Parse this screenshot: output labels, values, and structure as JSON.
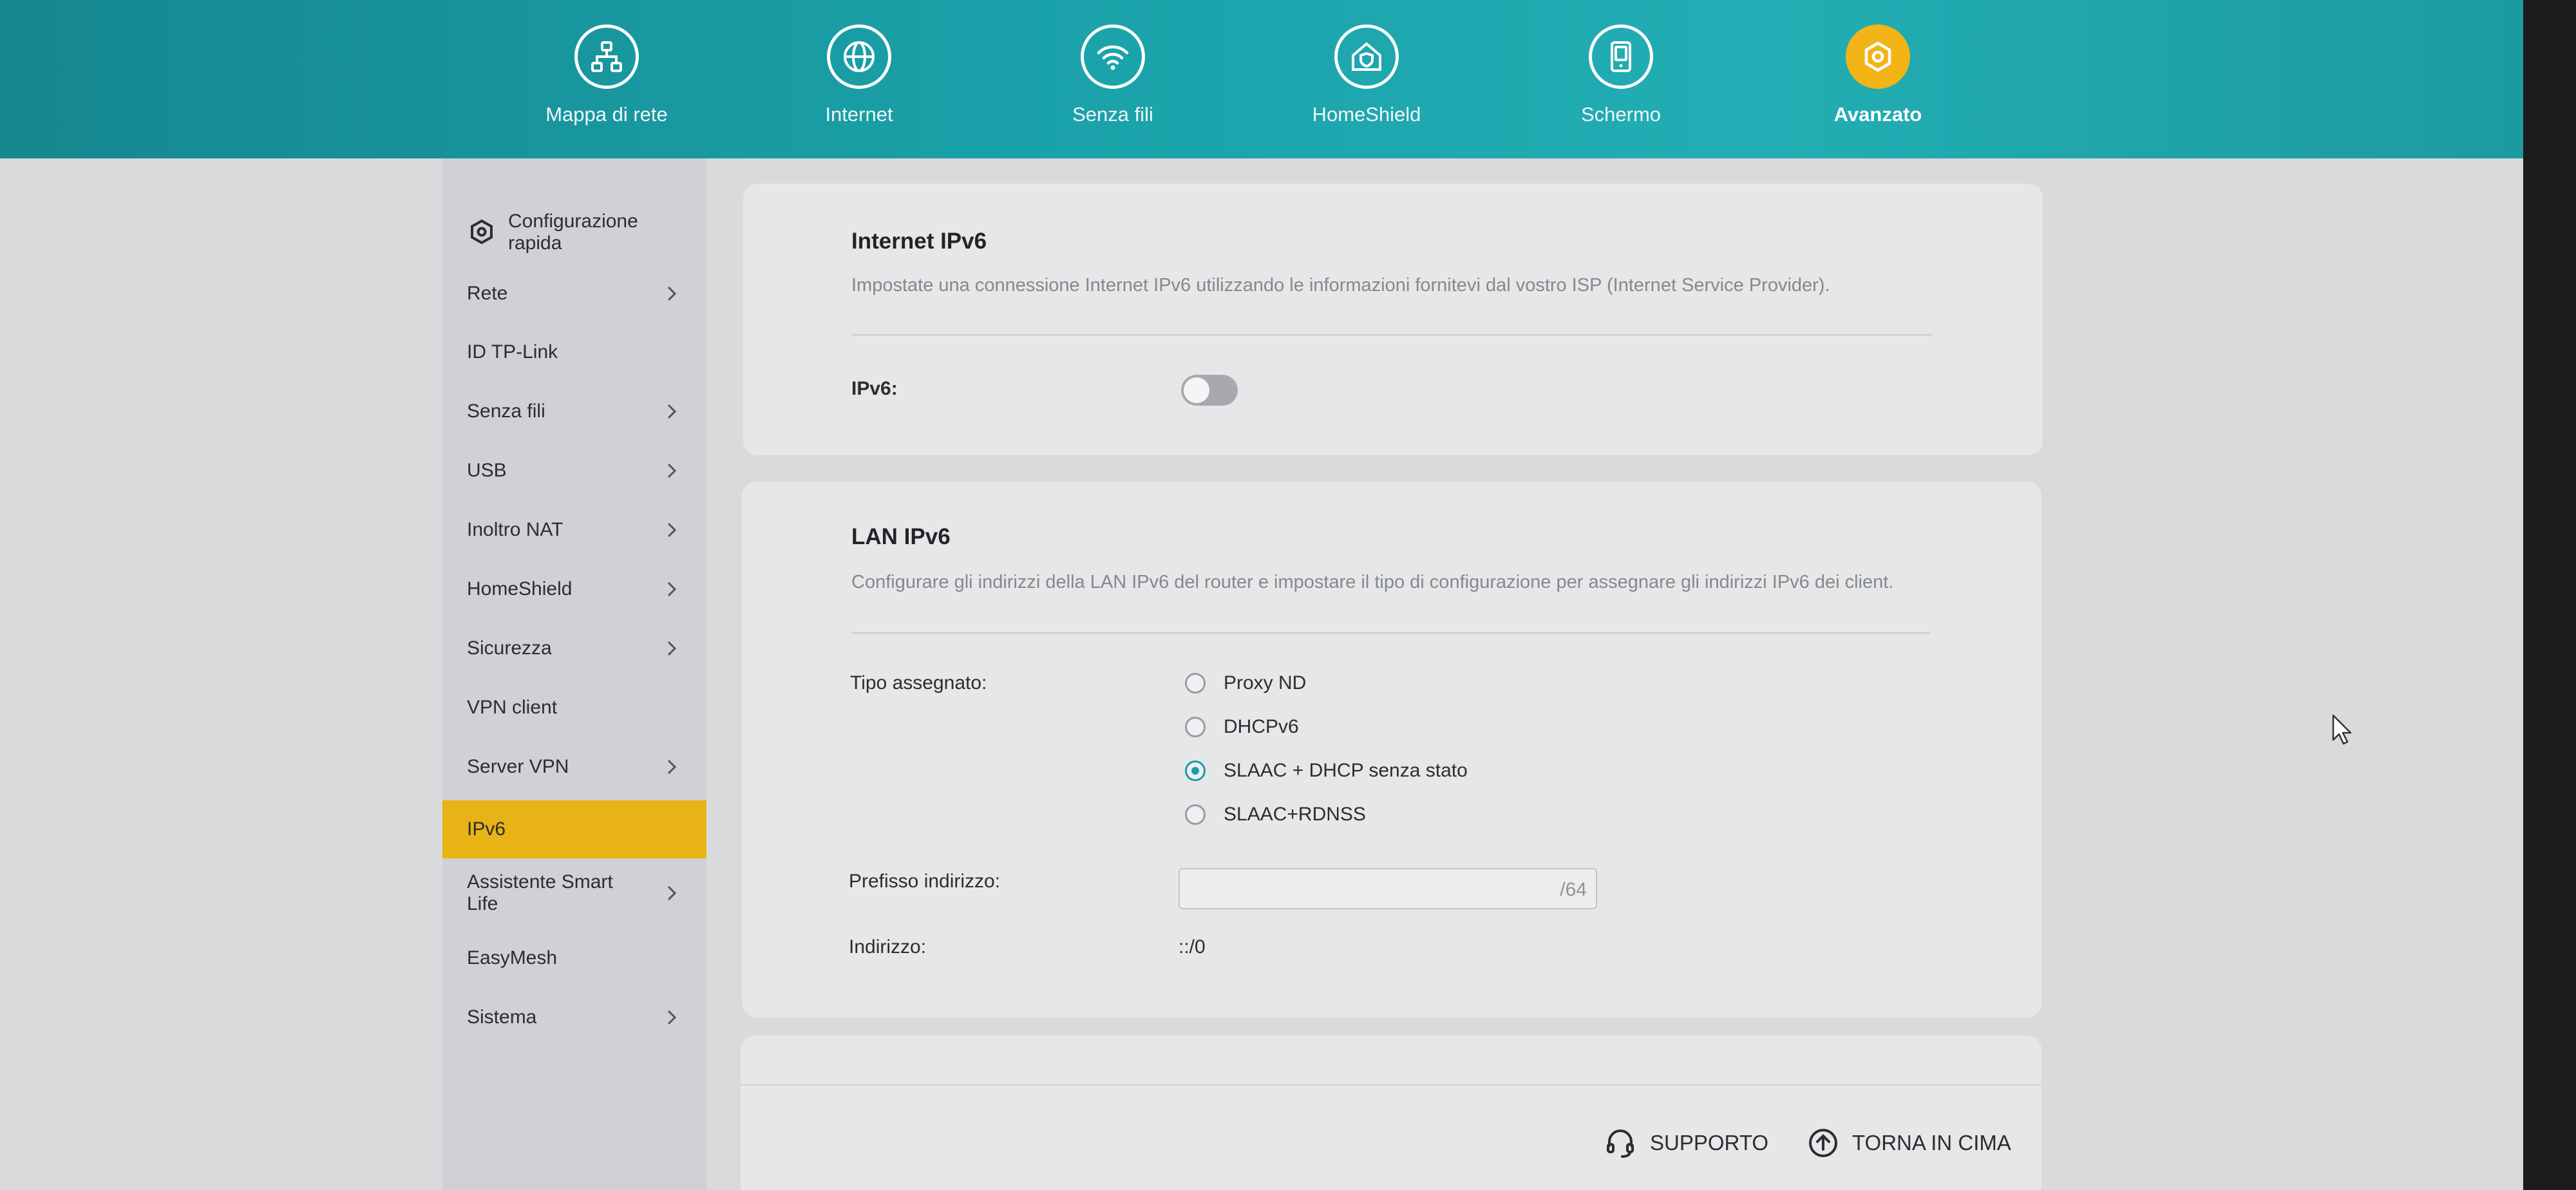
{
  "topnav": {
    "items": [
      {
        "label": "Mappa di rete",
        "icon": "network-map-icon",
        "active": false
      },
      {
        "label": "Internet",
        "icon": "globe-icon",
        "active": false
      },
      {
        "label": "Senza fili",
        "icon": "wifi-icon",
        "active": false
      },
      {
        "label": "HomeShield",
        "icon": "home-shield-icon",
        "active": false
      },
      {
        "label": "Schermo",
        "icon": "screen-device-icon",
        "active": false
      },
      {
        "label": "Avanzato",
        "icon": "gear-icon",
        "active": true
      }
    ],
    "active_color": "#f2b416"
  },
  "sidebar": {
    "quick_setup": "Configurazione rapida",
    "items": [
      {
        "label": "Rete",
        "chevron": true
      },
      {
        "label": "ID TP-Link",
        "chevron": false
      },
      {
        "label": "Senza fili",
        "chevron": true
      },
      {
        "label": "USB",
        "chevron": true
      },
      {
        "label": "Inoltro NAT",
        "chevron": true
      },
      {
        "label": "HomeShield",
        "chevron": true
      },
      {
        "label": "Sicurezza",
        "chevron": true
      },
      {
        "label": "VPN client",
        "chevron": false
      },
      {
        "label": "Server VPN",
        "chevron": true
      },
      {
        "label": "IPv6",
        "chevron": false,
        "active": true
      },
      {
        "label": "Assistente Smart Life",
        "chevron": true
      },
      {
        "label": "EasyMesh",
        "chevron": false
      },
      {
        "label": "Sistema",
        "chevron": true
      }
    ],
    "active_color": "#e8b315"
  },
  "internet_ipv6": {
    "title": "Internet IPv6",
    "description": "Impostate una connessione Internet IPv6 utilizzando le informazioni fornitevi dal vostro ISP (Internet Service Provider).",
    "toggle_label": "IPv6:",
    "toggle_on": false
  },
  "lan_ipv6": {
    "title": "LAN IPv6",
    "description": "Configurare gli indirizzi della LAN IPv6 del router e impostare il tipo di configurazione per assegnare gli indirizzi IPv6 dei client.",
    "assign_type_label": "Tipo assegnato:",
    "options": [
      {
        "label": "Proxy ND",
        "checked": false
      },
      {
        "label": "DHCPv6",
        "checked": false
      },
      {
        "label": "SLAAC + DHCP senza stato",
        "checked": true
      },
      {
        "label": "SLAAC+RDNSS",
        "checked": false
      }
    ],
    "prefix_label": "Prefisso indirizzo:",
    "prefix_value": "",
    "prefix_suffix": "/64",
    "address_label": "Indirizzo:",
    "address_value": "::/0"
  },
  "footer": {
    "support": "SUPPORTO",
    "back_to_top": "TORNA IN CIMA"
  }
}
